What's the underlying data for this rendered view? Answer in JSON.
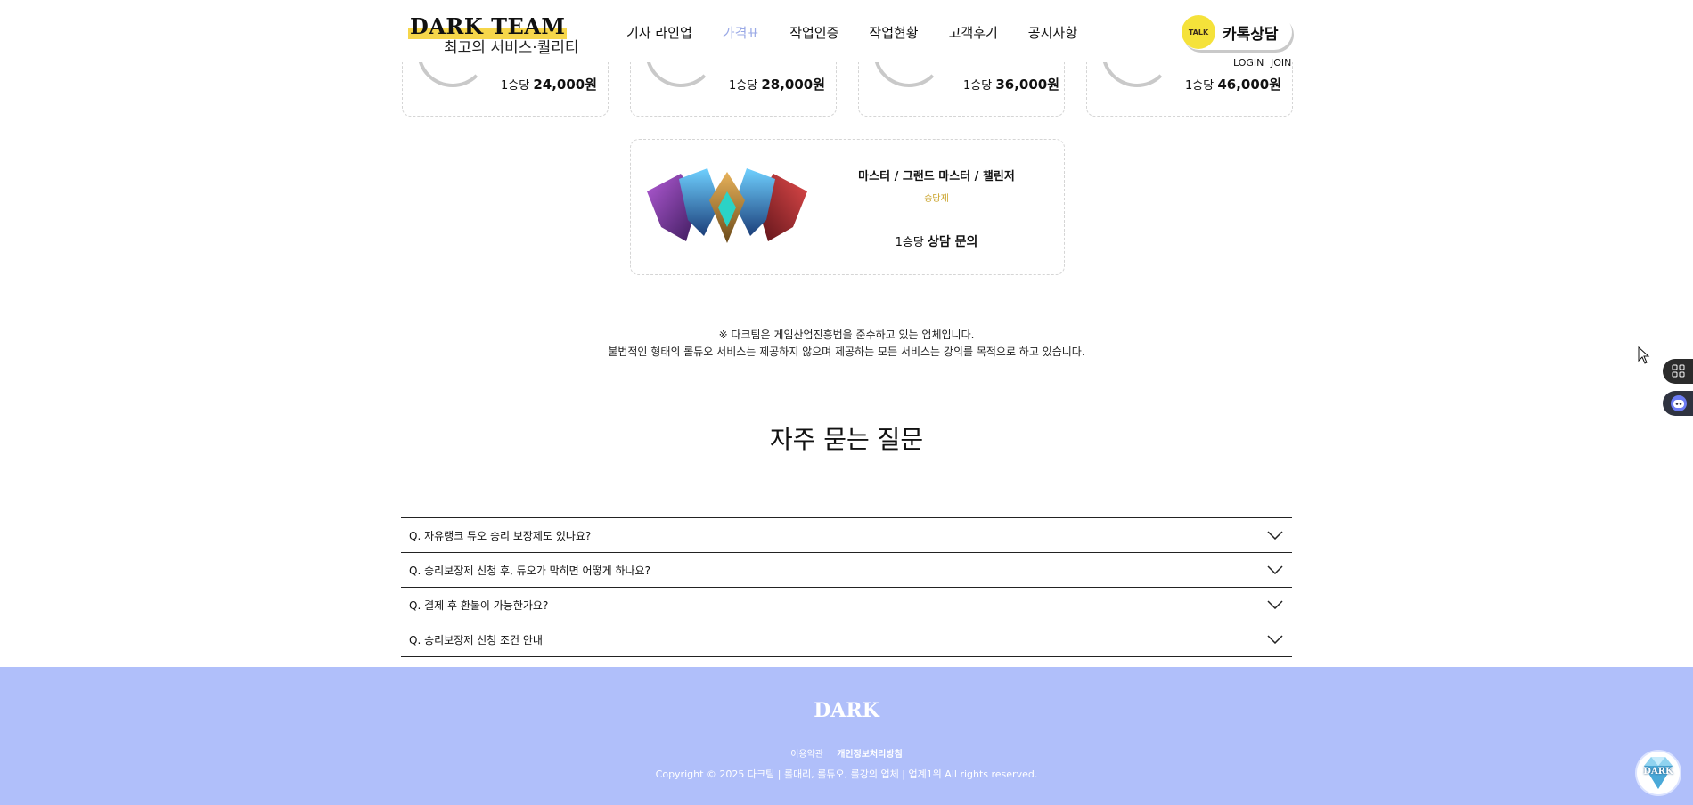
{
  "header": {
    "logo_title": "DARK TEAM",
    "logo_subtitle": "최고의 서비스·퀄리티",
    "nav": [
      "기사 라인업",
      "가격표",
      "작업인증",
      "작업현황",
      "고객후기",
      "공지사항"
    ],
    "active_nav": "가격표",
    "kakao_badge": "TALK",
    "kakao_label": "카톡상담",
    "login": "LOGIN",
    "join": "JOIN"
  },
  "price_cards": [
    {
      "unit": "1승당",
      "price": "24,000원"
    },
    {
      "unit": "1승당",
      "price": "28,000원"
    },
    {
      "unit": "1승당",
      "price": "36,000원"
    },
    {
      "unit": "1승당",
      "price": "46,000원"
    }
  ],
  "master_card": {
    "title": "마스터 / 그랜드 마스터 / 챌린저",
    "badge": "승당제",
    "unit": "1승당",
    "price": "상담 문의"
  },
  "notice": {
    "line1": "※ 다크팀은 게임산업진흥법을 준수하고 있는 업체입니다.",
    "line2": "불법적인 형태의 롤듀오 서비스는 제공하지 않으며 제공하는 모든 서비스는 강의를 목적으로 하고 있습니다."
  },
  "faq": {
    "title": "자주 묻는 질문",
    "items": [
      "Q. 자유랭크 듀오 승리 보장제도 있나요?",
      "Q. 승리보장제 신청 후, 듀오가 막히면 어떻게 하나요?",
      "Q. 결제 후 환불이 가능한가요?",
      "Q. 승리보장제 신청 조건 안내"
    ]
  },
  "footer": {
    "logo": "DARK",
    "links": [
      "이용약관",
      "개인정보처리방침"
    ],
    "copyright": "Copyright © 2025 다크팀 | 롤대리, 롤듀오, 롤강의 업체 | 업계1위 All rights reserved.",
    "badge_text": "DARK"
  },
  "colors": {
    "accent_nav": "#9aa9e6",
    "footer_bg": "#b0bffa",
    "kakao_yellow": "#f5e23a",
    "badge_gold": "#c9a227"
  },
  "icons": [
    "kakao-talk-icon",
    "chevron-down-icon",
    "grid-icon",
    "chatbot-icon",
    "mouse-cursor-icon",
    "diamond-icon"
  ]
}
